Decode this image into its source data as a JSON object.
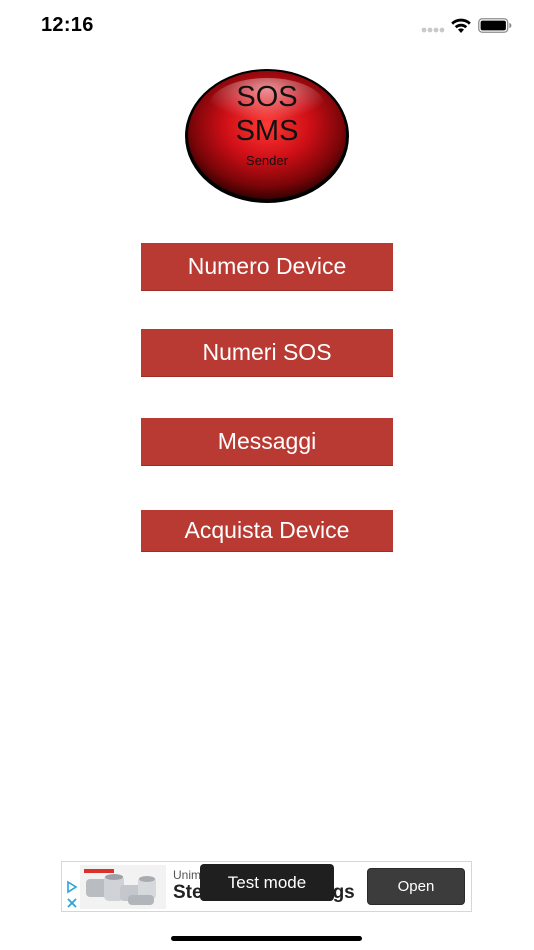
{
  "status_bar": {
    "time": "12:16",
    "icons": [
      "signal-dots-icon",
      "wifi-icon",
      "battery-icon"
    ]
  },
  "logo": {
    "line1": "SOS",
    "line2": "SMS",
    "line3": "Sender",
    "color": "#c0141c"
  },
  "menu": {
    "button_color": "#b93a33",
    "items": [
      {
        "label": "Numero Device"
      },
      {
        "label": "Numeri SOS"
      },
      {
        "label": "Messaggi"
      },
      {
        "label": "Acquista Device"
      }
    ]
  },
  "ad": {
    "brand": "Unim",
    "title": "Steel Pipe Fittings",
    "visible_title_left": "Ste",
    "visible_title_right": "gs",
    "open_label": "Open",
    "test_mode_label": "Test mode",
    "ad_choices_icon": "ad-choices-icon"
  }
}
